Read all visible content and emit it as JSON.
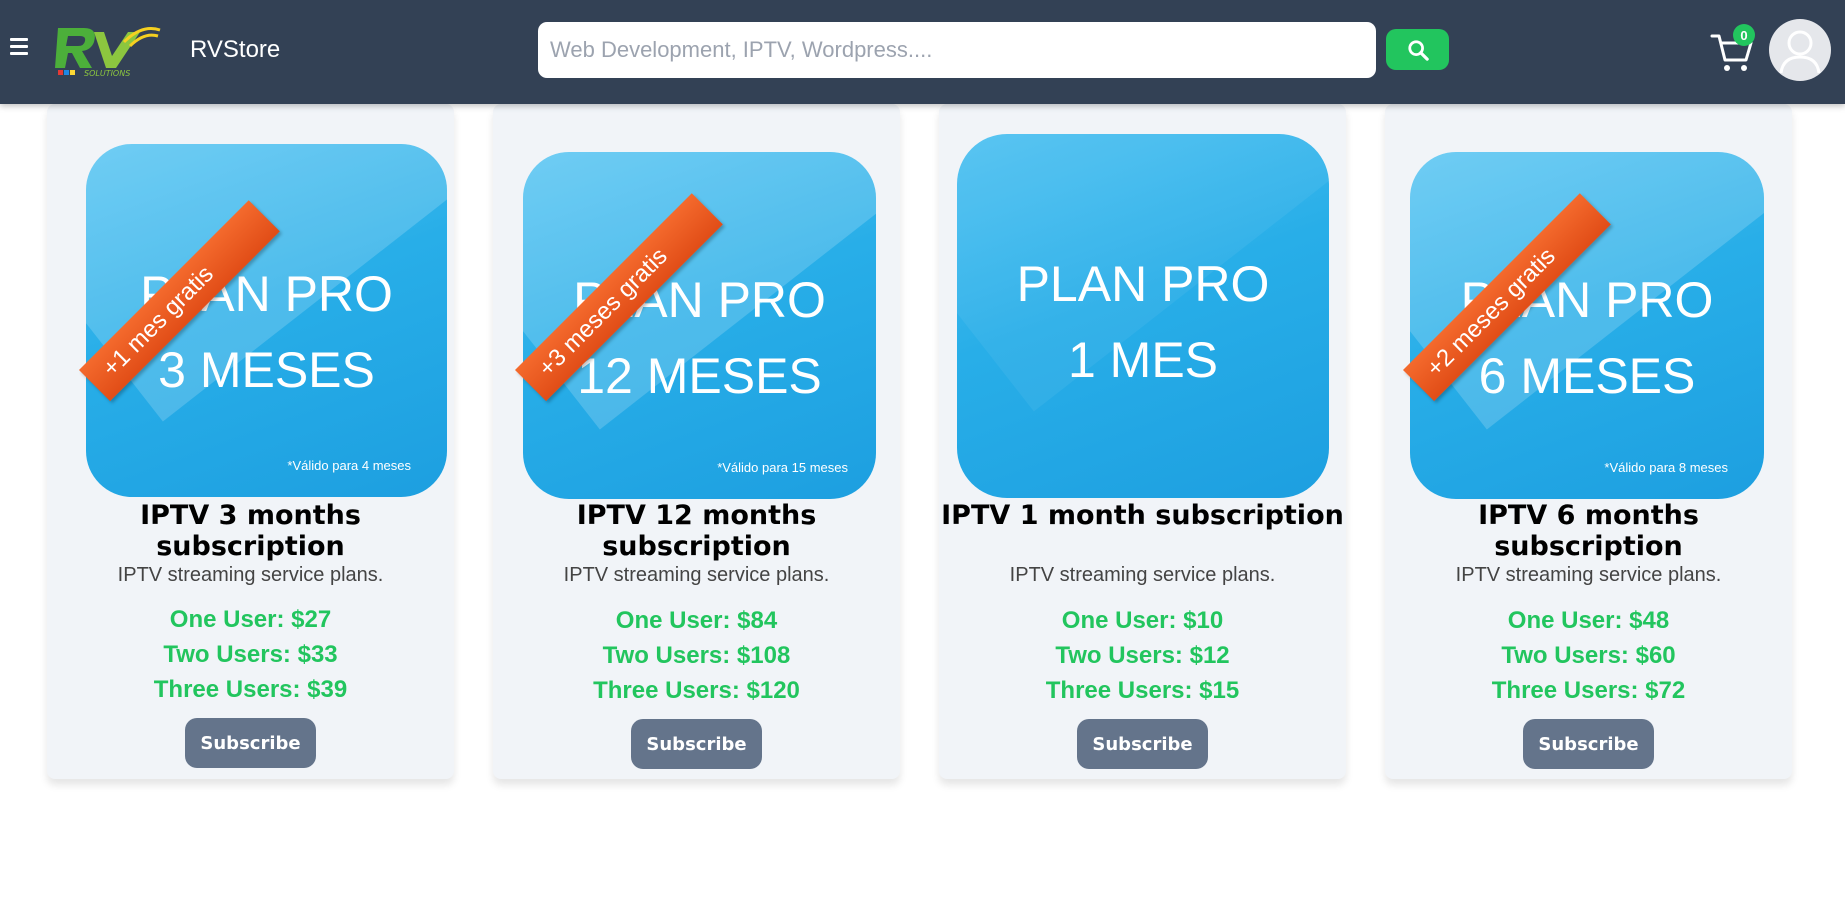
{
  "header": {
    "brand": "RVStore",
    "search_placeholder": "Web Development, IPTV, Wordpress....",
    "cart_count": "0",
    "logo_text": "SOLUTIONS"
  },
  "colors": {
    "header": "#334155",
    "accent": "#22c55e",
    "button": "#64748b",
    "card": "#f1f4f8"
  },
  "products": [
    {
      "image": {
        "line1": "PLAN PRO",
        "line2": "3 MESES",
        "ribbon": "+1 mes gratis",
        "valid": "*Válido para 4 meses"
      },
      "title": "IPTV 3 months subscription",
      "description": "IPTV streaming service plans.",
      "prices": [
        "One User: $27",
        "Two Users: $33",
        "Three Users: $39"
      ],
      "button": "Subscribe"
    },
    {
      "image": {
        "line1": "PLAN PRO",
        "line2": "12 MESES",
        "ribbon": "+3 meses gratis",
        "valid": "*Válido para 15 meses"
      },
      "title": "IPTV 12 months subscription",
      "description": "IPTV streaming service plans.",
      "prices": [
        "One User: $84",
        "Two Users: $108",
        "Three Users: $120"
      ],
      "button": "Subscribe"
    },
    {
      "image": {
        "line1": "PLAN PRO",
        "line2": "1 MES",
        "ribbon": "",
        "valid": ""
      },
      "title": "IPTV 1 month subscription",
      "description": "IPTV streaming service plans.",
      "prices": [
        "One User: $10",
        "Two Users: $12",
        "Three Users: $15"
      ],
      "button": "Subscribe"
    },
    {
      "image": {
        "line1": "PLAN PRO",
        "line2": "6 MESES",
        "ribbon": "+2 meses gratis",
        "valid": "*Válido para 8 meses"
      },
      "title": "IPTV 6 months subscription",
      "description": "IPTV streaming service plans.",
      "prices": [
        "One User: $48",
        "Two Users: $60",
        "Three Users: $72"
      ],
      "button": "Subscribe"
    }
  ]
}
